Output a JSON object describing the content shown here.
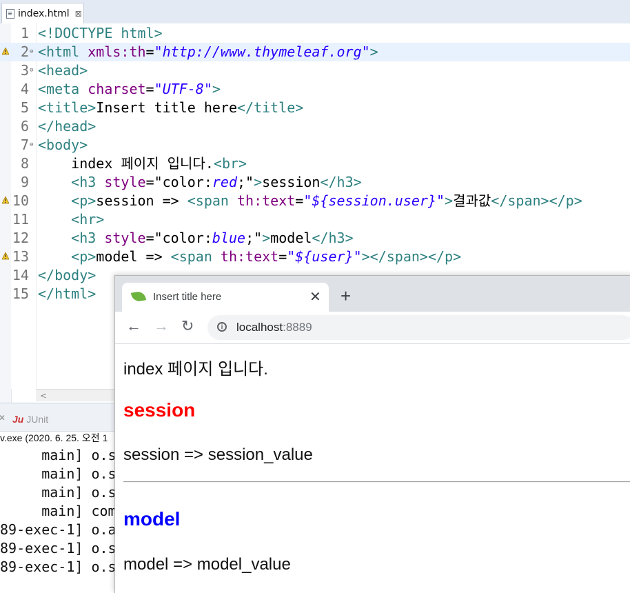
{
  "editor": {
    "tab_label": "index.html",
    "tab_close": "⊠",
    "lines": [
      {
        "num": "1",
        "parts": [
          [
            "t",
            "<!DOCTYPE html>"
          ]
        ]
      },
      {
        "num": "2",
        "parts": [
          [
            "t",
            "<html "
          ],
          [
            "a",
            "xmls:th"
          ],
          [
            "x",
            "="
          ],
          [
            "s",
            "\"http://www.thymeleaf.org\""
          ],
          [
            "t",
            ">"
          ]
        ]
      },
      {
        "num": "3",
        "parts": [
          [
            "t",
            "<head>"
          ]
        ]
      },
      {
        "num": "4",
        "parts": [
          [
            "t",
            "<meta "
          ],
          [
            "a",
            "charset"
          ],
          [
            "x",
            "="
          ],
          [
            "s",
            "\"UTF-8\""
          ],
          [
            "t",
            ">"
          ]
        ]
      },
      {
        "num": "5",
        "parts": [
          [
            "t",
            "<title>"
          ],
          [
            "x",
            "Insert title here"
          ],
          [
            "t",
            "</title>"
          ]
        ]
      },
      {
        "num": "6",
        "parts": [
          [
            "t",
            "</head>"
          ]
        ]
      },
      {
        "num": "7",
        "parts": [
          [
            "t",
            "<body>"
          ]
        ]
      },
      {
        "num": "8",
        "parts": [
          [
            "x",
            "    index 페이지 입니다."
          ],
          [
            "t",
            "<br>"
          ]
        ]
      },
      {
        "num": "9",
        "parts": [
          [
            "x",
            "    "
          ],
          [
            "t",
            "<h3 "
          ],
          [
            "a",
            "style"
          ],
          [
            "x",
            "=\"color:"
          ],
          [
            "s",
            "red"
          ],
          [
            "x",
            ";\""
          ],
          [
            "t",
            ">"
          ],
          [
            "x",
            "session"
          ],
          [
            "t",
            "</h3>"
          ]
        ]
      },
      {
        "num": "10",
        "parts": [
          [
            "x",
            "    "
          ],
          [
            "t",
            "<p>"
          ],
          [
            "x",
            "session => "
          ],
          [
            "t",
            "<span "
          ],
          [
            "a",
            "th:text"
          ],
          [
            "x",
            "="
          ],
          [
            "s",
            "\"${session.user}\""
          ],
          [
            "t",
            ">"
          ],
          [
            "x",
            "결과값"
          ],
          [
            "t",
            "</span></p>"
          ]
        ]
      },
      {
        "num": "11",
        "parts": [
          [
            "x",
            "    "
          ],
          [
            "t",
            "<hr>"
          ]
        ]
      },
      {
        "num": "12",
        "parts": [
          [
            "x",
            "    "
          ],
          [
            "t",
            "<h3 "
          ],
          [
            "a",
            "style"
          ],
          [
            "x",
            "=\"color:"
          ],
          [
            "s",
            "blue"
          ],
          [
            "x",
            ";\""
          ],
          [
            "t",
            ">"
          ],
          [
            "x",
            "model"
          ],
          [
            "t",
            "</h3>"
          ]
        ]
      },
      {
        "num": "13",
        "parts": [
          [
            "x",
            "    "
          ],
          [
            "t",
            "<p>"
          ],
          [
            "x",
            "model => "
          ],
          [
            "t",
            "<span "
          ],
          [
            "a",
            "th:text"
          ],
          [
            "x",
            "="
          ],
          [
            "s",
            "\"${user}\""
          ],
          [
            "t",
            "></span></p>"
          ]
        ]
      },
      {
        "num": "14",
        "parts": [
          [
            "t",
            "</body>"
          ]
        ]
      },
      {
        "num": "15",
        "parts": [
          [
            "t",
            "</html>"
          ]
        ]
      }
    ],
    "highlighted_line": "2",
    "fold_lines": [
      "2",
      "3",
      "7"
    ],
    "warning_lines": [
      "2",
      "10",
      "13"
    ]
  },
  "console": {
    "tab_label": "JUnit",
    "info": "v.exe  (2020. 6. 25. 오전 1",
    "lines": [
      "     main] o.s",
      "     main] o.s",
      "     main] o.s",
      "     main] com",
      "89-exec-1] o.a",
      "89-exec-1] o.s",
      "89-exec-1] o.s"
    ]
  },
  "browser": {
    "tab_title": "Insert title here",
    "tab_close": "✕",
    "new_tab": "+",
    "back": "←",
    "forward": "→",
    "reload": "↻",
    "url_host": "localhost",
    "url_port": ":8889",
    "page": {
      "intro": "index 페이지 입니다.",
      "h3_session": "session",
      "session_line": "session => session_value",
      "h3_model": "model",
      "model_line": "model => model_value"
    },
    "colors": {
      "session": "#ff0000",
      "model": "#0000ff"
    }
  }
}
